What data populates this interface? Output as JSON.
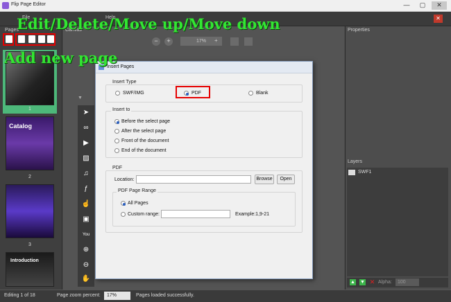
{
  "window": {
    "title": "Flip Page Editor",
    "minimize": "—",
    "maximize": "▢",
    "close": "✕",
    "corner_close": "✕"
  },
  "menu": {
    "file": "File",
    "help": "Help"
  },
  "pages_panel": {
    "title": "Pages",
    "thumbnails": [
      {
        "label": "1",
        "caption": ""
      },
      {
        "label": "2",
        "caption": "Catalog"
      },
      {
        "label": "3",
        "caption": ""
      },
      {
        "label": "",
        "caption": "Introduction"
      }
    ]
  },
  "canvas": {
    "title": "Canvas",
    "zoom_value": "17%",
    "zoom_minus": "−",
    "zoom_plus": "+",
    "zoom_field_plus": "+"
  },
  "tools": [
    {
      "icon": "pointer-icon",
      "glyph": "➤"
    },
    {
      "icon": "link-icon",
      "glyph": "∞"
    },
    {
      "icon": "video-icon",
      "glyph": "▶"
    },
    {
      "icon": "image-icon",
      "glyph": "▨"
    },
    {
      "icon": "headphones-icon",
      "glyph": "♫"
    },
    {
      "icon": "flash-icon",
      "glyph": "ƒ"
    },
    {
      "icon": "hand-click-icon",
      "glyph": "☝"
    },
    {
      "icon": "picture-icon",
      "glyph": "▣"
    },
    {
      "icon": "youtube-icon",
      "glyph": "You"
    },
    {
      "icon": "zoom-in-icon",
      "glyph": "⊕"
    },
    {
      "icon": "zoom-out-icon",
      "glyph": "⊖"
    },
    {
      "icon": "hand-pan-icon",
      "glyph": "✋"
    }
  ],
  "properties": {
    "title": "Properties"
  },
  "layers": {
    "title": "Layers",
    "items": [
      "SWF1"
    ],
    "alpha_label": "Alpha:",
    "alpha_value": "100"
  },
  "status": {
    "editing": "Editing 1 of 18",
    "zoom_label": "Page zoom percent:",
    "zoom_value": "17%",
    "message": "Pages loaded successfully."
  },
  "dialog": {
    "title": "Insert Pages",
    "insert_type": {
      "label": "Insert Type",
      "options": [
        "SWF/IMG",
        "PDF",
        "Blank"
      ],
      "selected": "PDF"
    },
    "insert_to": {
      "label": "Insert to",
      "options": [
        "Before the select page",
        "After the select page",
        "Front of the document",
        "End of the document"
      ],
      "selected": "Before the select page"
    },
    "pdf": {
      "label": "PDF",
      "location_label": "Location:",
      "location_value": "",
      "browse": "Browse",
      "open": "Open",
      "range_label": "PDF Page Range",
      "all_pages": "All Pages",
      "custom_range": "Custom range:",
      "custom_value": "",
      "example": "Example:1,9-21"
    }
  },
  "annotations": {
    "top": "Edit/Delete/Move up/Move down",
    "add": "Add new page"
  },
  "colors": {
    "annotation_green": "#33e633",
    "highlight_red": "#e60000",
    "selected_page_green": "#4db87a"
  }
}
